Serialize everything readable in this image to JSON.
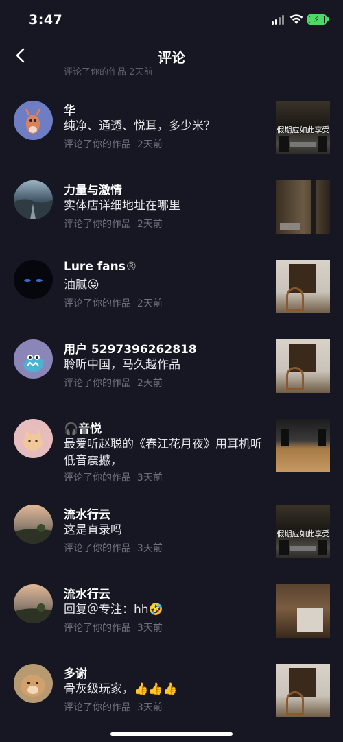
{
  "status_bar": {
    "time": "3:47"
  },
  "header": {
    "title": "评论"
  },
  "partial_meta": "评论了你的作品  2天前",
  "comments": [
    {
      "name": "华",
      "text": "纯净、通透、悦耳，多少米？",
      "action": "评论了你的作品",
      "time": "2天前",
      "thumb_caption": "假期应如此享受"
    },
    {
      "name": "力量与激情",
      "text": "实体店详细地址在哪里",
      "action": "评论了你的作品",
      "time": "2天前",
      "thumb_caption": ""
    },
    {
      "name": "Lure  fans",
      "text": "油腻",
      "action": "评论了你的作品",
      "time": "2天前",
      "thumb_caption": ""
    },
    {
      "name": "用户 5297396262818",
      "text": "聆听中国，马久越作品",
      "action": "评论了你的作品",
      "time": "2天前",
      "thumb_caption": ""
    },
    {
      "name": "音悦",
      "text": "最爱听赵聪的《春江花月夜》用耳机听低音震撼，",
      "action": "评论了你的作品",
      "time": "3天前",
      "thumb_caption": ""
    },
    {
      "name": "流水行云",
      "text": "这是直录吗",
      "action": "评论了你的作品",
      "time": "3天前",
      "thumb_caption": "假期应如此享受"
    },
    {
      "name": "流水行云",
      "text": "回复＠专注：hh",
      "action": "评论了你的作品",
      "time": "3天前",
      "thumb_caption": ""
    },
    {
      "name": "多谢",
      "text": "骨灰级玩家，",
      "action": "评论了你的作品",
      "time": "3天前",
      "thumb_caption": ""
    }
  ]
}
